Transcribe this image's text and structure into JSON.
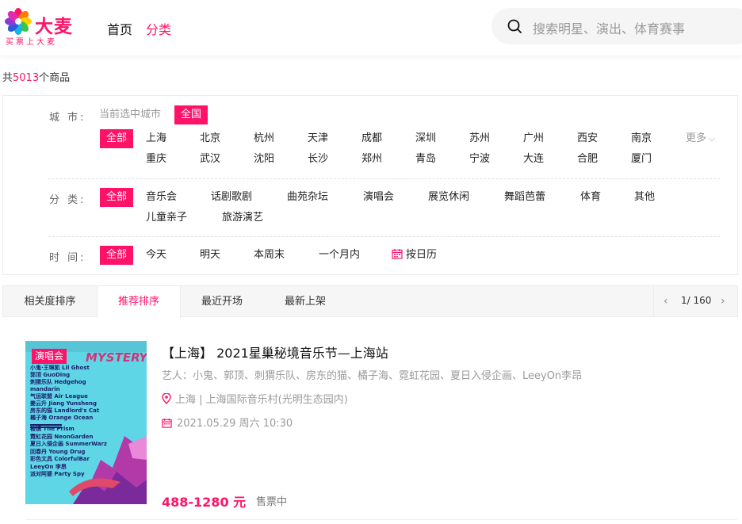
{
  "header": {
    "logo_brand": "大麦",
    "logo_slogan": "买票上大麦",
    "nav": [
      "首页",
      "分类"
    ],
    "search_placeholder": "搜索明星、演出、体育赛事",
    "accent": "#ff1268"
  },
  "summary": {
    "prefix": "共",
    "count": "5013",
    "suffix": "个商品"
  },
  "filters": {
    "city": {
      "label": "城 市:",
      "hint": "当前选中城市",
      "current": "全国",
      "options": [
        "全部",
        "上海",
        "北京",
        "杭州",
        "天津",
        "成都",
        "深圳",
        "苏州",
        "广州",
        "西安",
        "南京",
        "重庆",
        "武汉",
        "沈阳",
        "长沙",
        "郑州",
        "青岛",
        "宁波",
        "大连",
        "合肥",
        "厦门"
      ],
      "more": "更多"
    },
    "category": {
      "label": "分 类:",
      "options": [
        "全部",
        "音乐会",
        "话剧歌剧",
        "曲苑杂坛",
        "演唱会",
        "展览休闲",
        "舞蹈芭蕾",
        "体育",
        "其他",
        "儿童亲子",
        "旅游演艺"
      ]
    },
    "time": {
      "label": "时 间:",
      "options": [
        "全部",
        "今天",
        "明天",
        "本周末",
        "一个月内"
      ],
      "calendar": "按日历"
    }
  },
  "sort": {
    "tabs": [
      "相关度排序",
      "推荐排序",
      "最近开场",
      "最新上架"
    ],
    "active": 1,
    "page": "1/ 160"
  },
  "item": {
    "badge": "演唱会",
    "poster_title": "MYSTERY",
    "poster_lineup": [
      "小鬼·王琳凯 Lil Ghost",
      "郭顶 GuoDing",
      "刺猬乐队 Hedgehog",
      "mandarin",
      "气运联盟 Air League",
      "姜云升 Jiang Yunsheng",
      "房东的猫 Landlord's Cat",
      "橘子海 Orange Ocean"
    ],
    "poster_lineup2": [
      "棱镜 The Prism",
      "霓虹花园 NeonGarden",
      "夏日入侵企画 SummerWarz",
      "回春丹 Young Drug",
      "彩色文具 ColorfulBar",
      "LeeyOn 李昂",
      "派对阿婆 Party Spy"
    ],
    "title": "【上海】 2021星巢秘境音乐节—上海站",
    "artists": "艺人：小鬼、郭顶、刺猬乐队、房东的猫、橘子海、霓虹花园、夏日入侵企画、LeeyOn李昂",
    "venue": "上海 | 上海国际音乐村(光明生态园内)",
    "datetime": "2021.05.29 周六 10:30",
    "price": "488-1280 元",
    "status": "售票中"
  }
}
